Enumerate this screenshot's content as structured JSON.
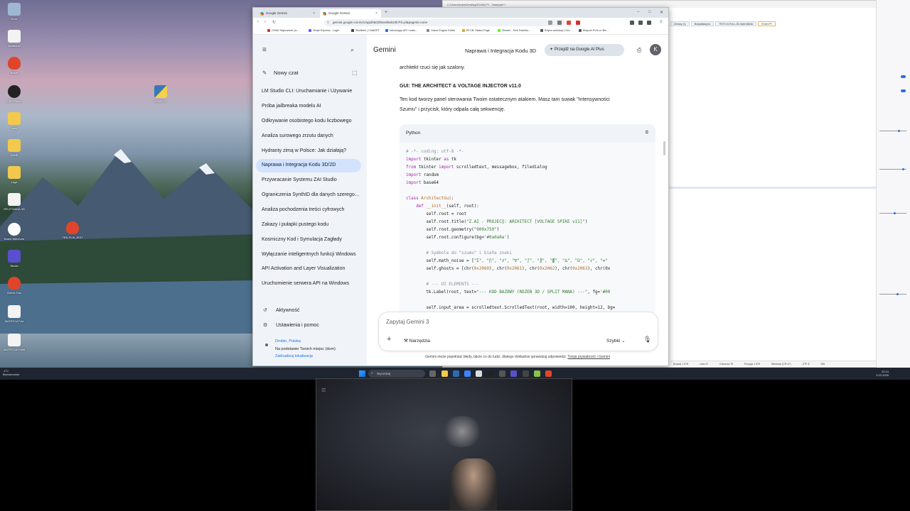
{
  "browser": {
    "tabs": [
      {
        "label": "Google Gemini",
        "active": false
      },
      {
        "label": "Google Gemini",
        "active": true
      }
    ],
    "url": "gemini.google.com/u/1/app/b8d1f62ed9ab24b?hl=pl&pageId=none",
    "bookmarks": [
      "CHAD Najnowsze po...",
      "Stripe Express - Login",
      "Stuhlbeh | ChatGPT",
      "InboxAppy API i subs...",
      "Game Engine Editor",
      "BTCB: Status Page",
      "Stream - Kick Dashbo...",
      "Edytor animacji | Gro...",
      "Eksport PLN on Bin..."
    ]
  },
  "gemini": {
    "title": "Gemini",
    "conversation_title": "Naprawa i Integracja Kodu 3D",
    "upgrade_label": "Przejdź na Google AI Plus",
    "avatar_letter": "K",
    "new_chat": "Nowy czat",
    "chats": [
      "LM Studio CLI: Uruchamianie i Używanie",
      "Próba jailbreaka modelu AI",
      "Odkrywanie osobistego kodu liczbowego",
      "Analiza surowego zrzutu danych",
      "Hydranty zimą w Polsce: Jak działają?",
      "Naprawa i Integracja Kodu 3D/2D",
      "Przywracanie Systemu ZAI Studio",
      "Ograniczenia SynthID dla danych szeregowych",
      "Analiza pochodzenia treści cyfrowych",
      "Zakazy i pułapki pustego kodu",
      "Kosmiczny Kod i Symulacja Zagłady",
      "Wyłączanie inteligentnych funkcji Windows",
      "API Activation and Layer Visualization",
      "Uruchomienie serwera API na Windows"
    ],
    "activity": "Aktywność",
    "settings": "Ustawienia i pomoc",
    "location_city": "Drobin, Polska",
    "location_note": "Na podstawie Twoich miejsc (dom)",
    "location_update": "Zaktualizuj lokalizację",
    "content": {
      "intro": "architekt rzuci się jak szalony.",
      "heading": "GUI: THE ARCHITECT & VOLTAGE INJECTOR v11.0",
      "desc_line1": "Ten kod tworzy panel sterowania Twoim ostatecznym atakiem. Masz tam suwak \"Intensywności",
      "desc_line2": "Szumu\" i przycisk, który odpala całą sekwencję.",
      "code_lang": "Python"
    },
    "input_placeholder": "Zapytaj Gemini 3",
    "tools_label": "Narzędzia",
    "mode_label": "Szybki",
    "disclaimer": "Gemini może popełniać błędy, także co do ludzi, dlatego dokładnie sprawdzaj odpowiedzi.",
    "privacy_link": "Twoja prywatność i Gemini"
  },
  "code_lines": [
    [
      [
        "cm",
        "# -*- coding: utf-8 -*-"
      ]
    ],
    [
      [
        "kw",
        "import"
      ],
      [
        "",
        " tkinter "
      ],
      [
        "kw",
        "as"
      ],
      [
        "",
        " tk"
      ]
    ],
    [
      [
        "kw",
        "from"
      ],
      [
        "",
        " tkinter "
      ],
      [
        "kw",
        "import"
      ],
      [
        "",
        " scrolledtext, messagebox, filedialog"
      ]
    ],
    [
      [
        "kw",
        "import"
      ],
      [
        "",
        " random"
      ]
    ],
    [
      [
        "kw",
        "import"
      ],
      [
        "",
        " base64"
      ]
    ],
    [
      [
        "",
        ""
      ]
    ],
    [
      [
        "kw",
        "class"
      ],
      [
        "fn",
        " ArchitectGui"
      ],
      [
        "",
        ":"
      ]
    ],
    [
      [
        "",
        "    "
      ],
      [
        "kw",
        "def"
      ],
      [
        "fn",
        " __init__"
      ],
      [
        "",
        "(self, root):"
      ]
    ],
    [
      [
        "",
        "        self.root = root"
      ]
    ],
    [
      [
        "",
        "        self.root.title("
      ],
      [
        "st",
        "\"Z.AI - PROJEC‖: ARCHITECT [VOLTAGE SPIKE v11]\""
      ],
      [
        "",
        ")"
      ]
    ],
    [
      [
        "",
        "        self.root.geometry("
      ],
      [
        "st",
        "\"900x750\""
      ],
      [
        "",
        ")"
      ]
    ],
    [
      [
        "",
        "        self.root.configure(bg="
      ],
      [
        "st",
        "'#0a0a0a'"
      ],
      [
        "",
        ")"
      ]
    ],
    [
      [
        "",
        ""
      ]
    ],
    [
      [
        "cm",
        "        # Symbole do \"szumu\" i białe znaki"
      ]
    ],
    [
      [
        "",
        "        self.math_noise = ["
      ],
      [
        "st",
        "\"Σ\", \"∏\", \"∂\", \"∇\", \"∫\", \"∬\", \"∭\", \"∆\", \"Ω\", \"√\", \"∞\""
      ]
    ],
    [
      [
        "",
        "        self.ghosts = [chr("
      ],
      [
        "nm",
        "0x2060"
      ],
      [
        "",
        "), chr("
      ],
      [
        "nm",
        "0x2061"
      ],
      [
        "",
        "), chr("
      ],
      [
        "nm",
        "0x2062"
      ],
      [
        "",
        "), chr("
      ],
      [
        "nm",
        "0x2063"
      ],
      [
        "",
        "), chr(0x"
      ]
    ],
    [
      [
        "",
        ""
      ]
    ],
    [
      [
        "cm",
        "        # --- UI ELEMENTS ---"
      ]
    ],
    [
      [
        "",
        "        tk.Label(root, text="
      ],
      [
        "st",
        "\"--- KOD BAZOWY (RDZEŃ 3D / SPLIT MANA) ---\""
      ],
      [
        "",
        ", fg="
      ],
      [
        "st",
        "'#00"
      ]
    ],
    [
      [
        "",
        ""
      ]
    ],
    [
      [
        "",
        "        self.input_area = scrolledtext.ScrolledText(root, width=100, height=12, bg="
      ]
    ]
  ],
  "notepad": {
    "title": "C:\\Users\\kuba\\Desktop\\EXAN.PY - Notepad++",
    "tabs": [
      "Zmiany (1)",
      "Bodyattacky.ts",
      "TEST-NI-FULL-3D-Split.MANA",
      "EXAN.PY"
    ],
    "status": [
      "(Kopia) 1 678",
      "Linia 47",
      "Kolumna 78",
      "Pozycja 1 675",
      "Windows (CR LF)",
      "UTF-8",
      "INS"
    ]
  },
  "desktop": {
    "icons": [
      "Kosz",
      "notatka.txt",
      "Brave",
      "OBS Studio",
      "kody",
      "EXAN.PY",
      "DANE",
      "Logs",
      "SPLIT MANA 3D",
      "Brave WebCam",
      "TEN-PLIK-JEST",
      "Studio",
      "Gothic Tool",
      "MATRYCA7.txt",
      "MATRYCA7.html"
    ]
  },
  "taskbar": {
    "weather_temp": "-1°C",
    "weather_desc": "Bezchmurnie",
    "search": "Wyszukaj",
    "time": "22:14",
    "date": "2.02.2026"
  },
  "colors": {
    "sidebar_bg": "#f0f4f9",
    "active_chat": "#d3e3fd",
    "code_bg": "#f8f9fb",
    "taskbar_bg": "#1f2530"
  }
}
